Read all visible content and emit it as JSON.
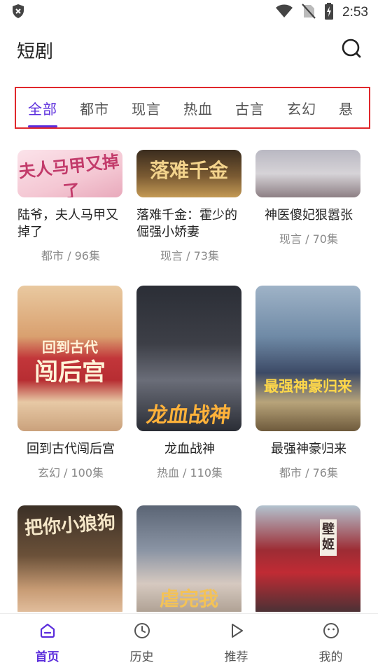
{
  "status_bar": {
    "time": "2:53",
    "icons": [
      "shield-icon",
      "wifi-icon",
      "no-sim-icon",
      "battery-charging-icon"
    ]
  },
  "header": {
    "title": "短剧",
    "search_icon": "search-icon"
  },
  "tabs": [
    {
      "label": "全部",
      "active": true
    },
    {
      "label": "都市",
      "active": false
    },
    {
      "label": "现言",
      "active": false
    },
    {
      "label": "热血",
      "active": false
    },
    {
      "label": "古言",
      "active": false
    },
    {
      "label": "玄幻",
      "active": false
    },
    {
      "label": "悬",
      "active": false
    }
  ],
  "cards": [
    {
      "title": "陆爷，夫人马甲又掉了",
      "meta": "都市 / 96集",
      "poster_text": "夫人马甲又掉了"
    },
    {
      "title": "落难千金：霍少的倔强小娇妻",
      "meta": "现言 / 73集",
      "poster_text": "落难千金"
    },
    {
      "title": "神医傻妃狠嚣张",
      "meta": "现言 / 70集"
    },
    {
      "title": "回到古代闯后宫",
      "meta": "玄幻 / 100集",
      "poster_text": [
        "回到古代",
        "闯后宫"
      ]
    },
    {
      "title": "龙血战神",
      "meta": "热血 / 110集",
      "poster_text": "龙血战神"
    },
    {
      "title": "最强神豪归来",
      "meta": "都市 / 76集",
      "poster_text": "最强神豪归来"
    },
    {
      "title": "",
      "meta": "",
      "poster_text": "把你小狼狗"
    },
    {
      "title": "",
      "meta": "",
      "poster_text": "虐完我"
    },
    {
      "title": "",
      "meta": "",
      "poster_text": "壁姬"
    }
  ],
  "bottom_nav": [
    {
      "label": "首页",
      "icon": "home-icon",
      "active": true
    },
    {
      "label": "历史",
      "icon": "clock-icon",
      "active": false
    },
    {
      "label": "推荐",
      "icon": "play-icon",
      "active": false
    },
    {
      "label": "我的",
      "icon": "smiley-icon",
      "active": false
    }
  ],
  "colors": {
    "accent": "#5b2ddc",
    "highlight_border": "#e0282c",
    "meta_text": "#8a8a8a"
  }
}
